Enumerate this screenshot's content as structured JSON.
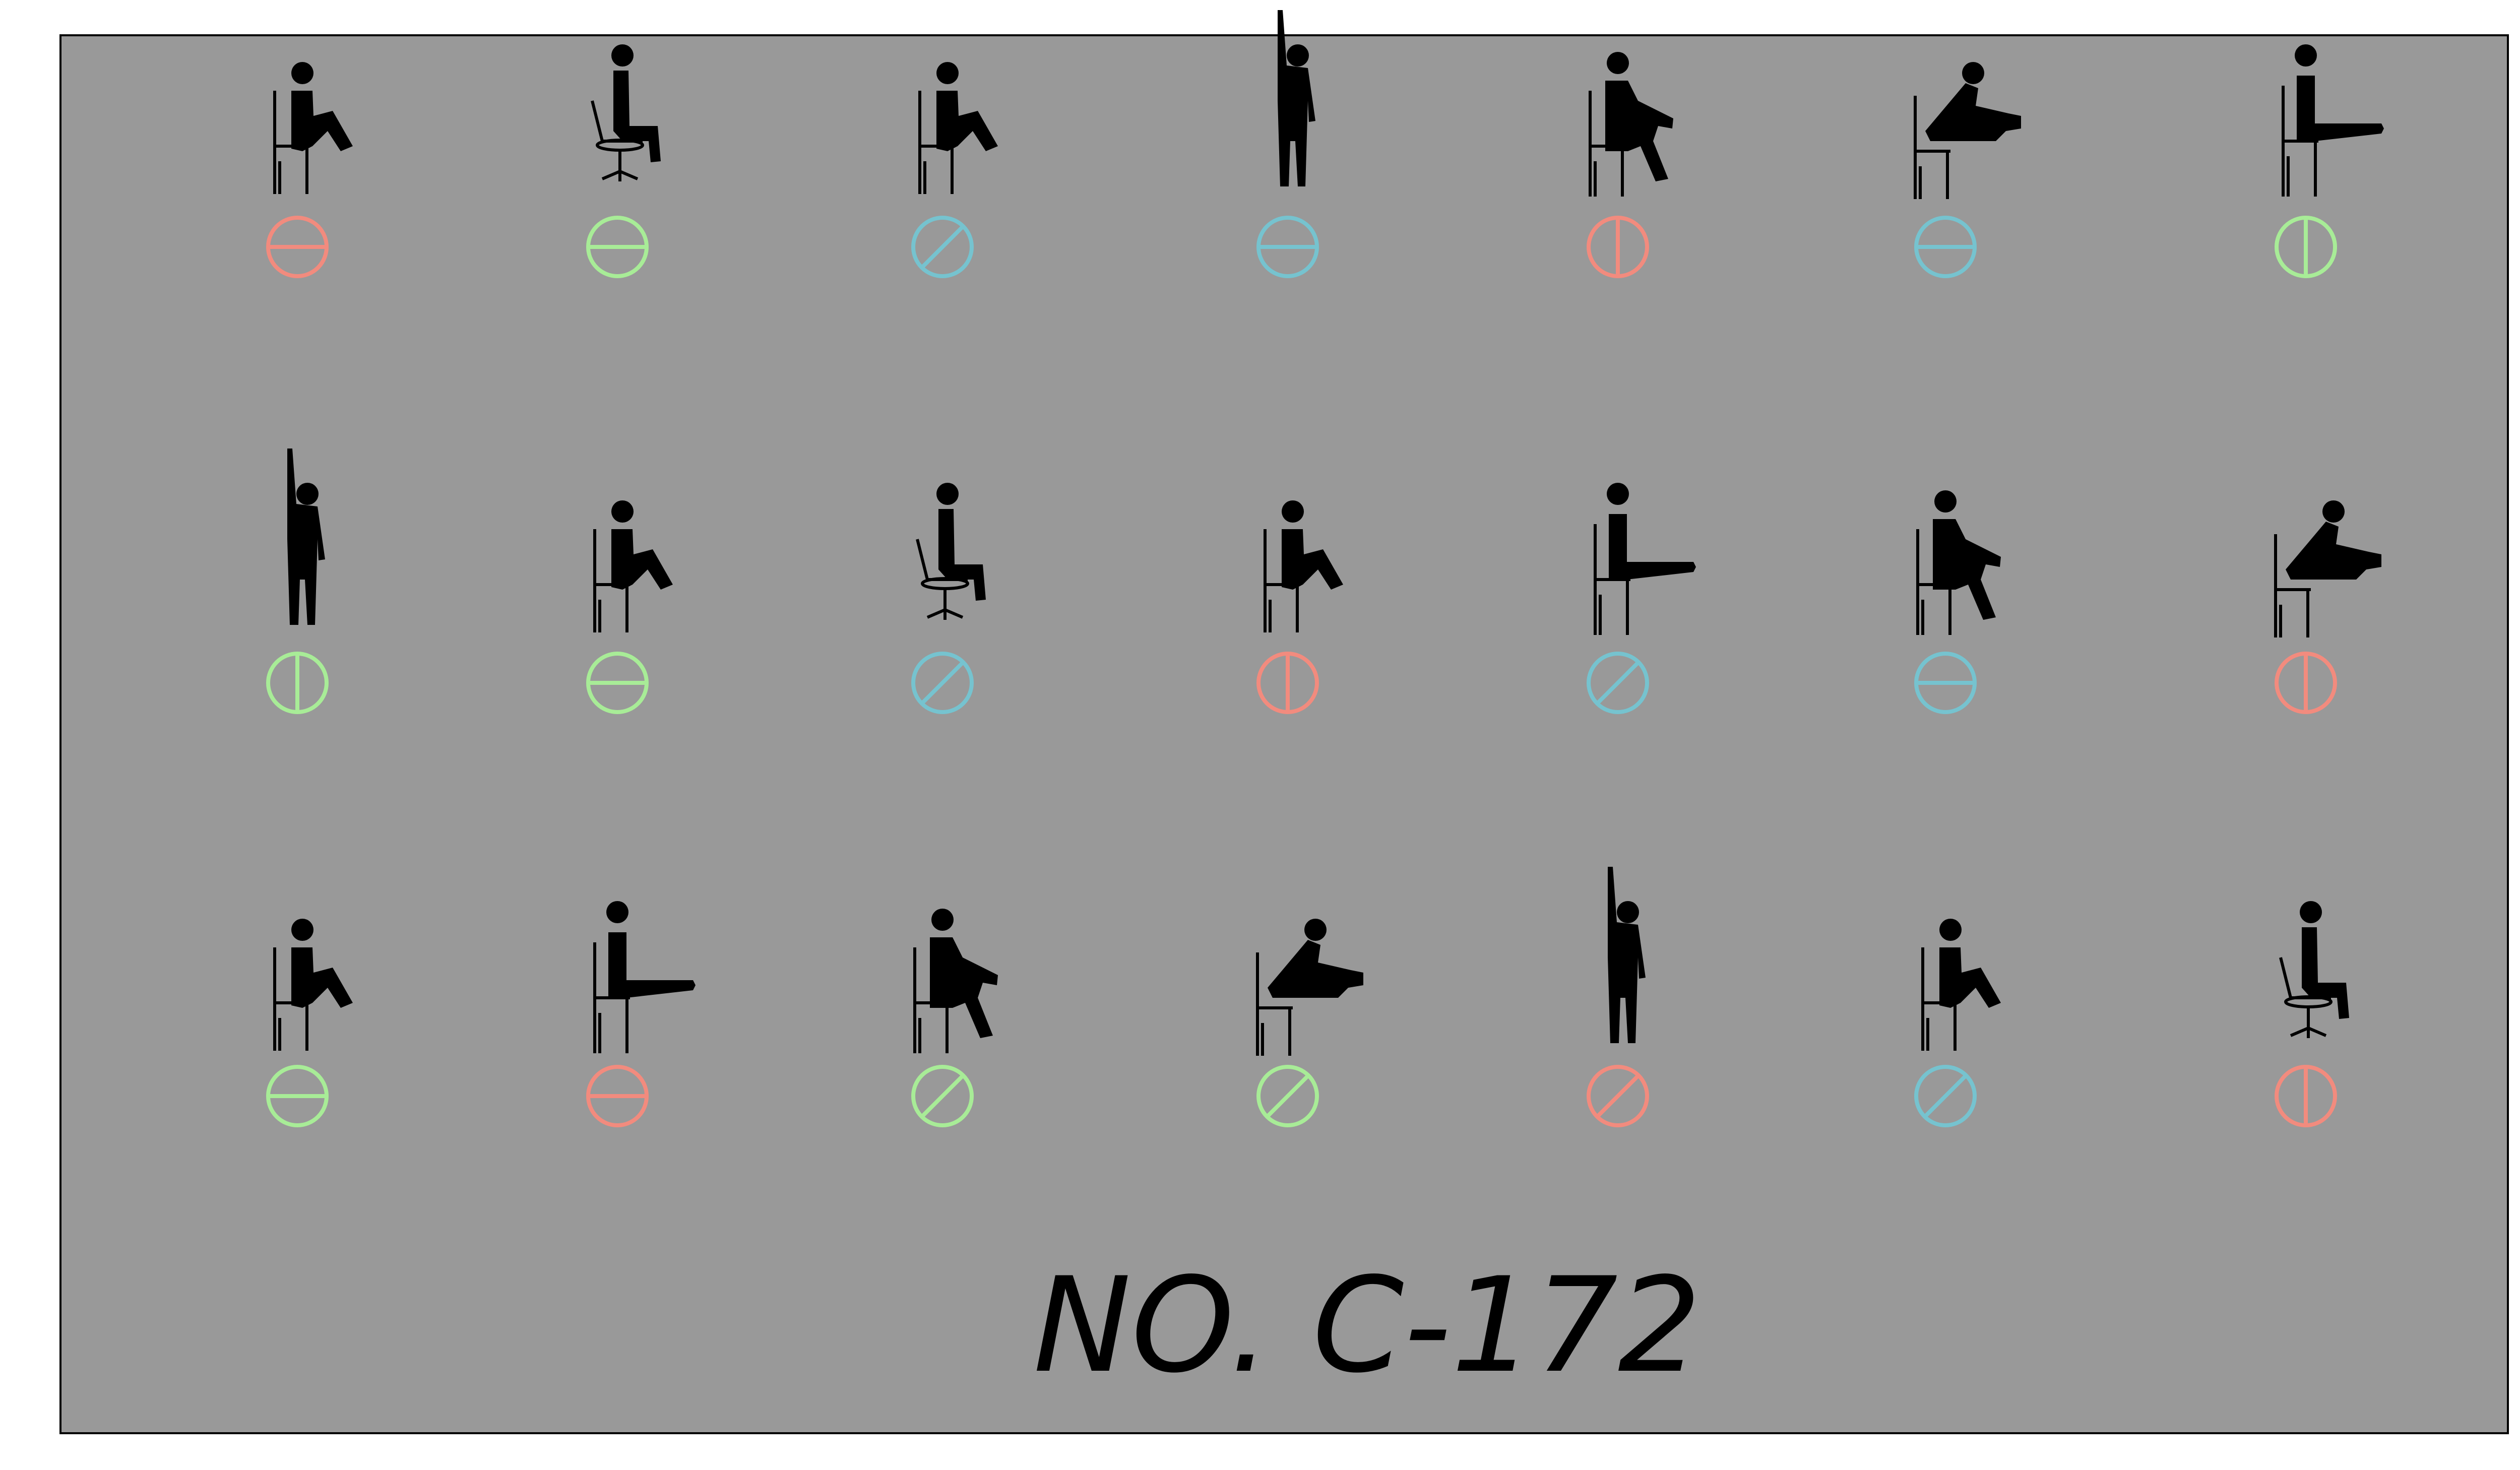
{
  "label": "NO. C-172",
  "colors": {
    "background": "#999999",
    "salmon": "#f28b7e",
    "green": "#a8ec97",
    "blue": "#76c3cf"
  },
  "rows": [
    [
      {
        "pose": "sit-knee-up",
        "symbol": "circle-horizontal-bar",
        "color": "salmon"
      },
      {
        "pose": "office-chair",
        "symbol": "circle-horizontal-bar",
        "color": "green"
      },
      {
        "pose": "sit-knee-up",
        "symbol": "circle-slash",
        "color": "blue"
      },
      {
        "pose": "stand-arm-raised",
        "symbol": "circle-horizontal-bar",
        "color": "blue"
      },
      {
        "pose": "sit-leg-stretch",
        "symbol": "circle-vertical-bar",
        "color": "salmon"
      },
      {
        "pose": "sit-reach-forward",
        "symbol": "circle-horizontal-bar",
        "color": "blue"
      },
      {
        "pose": "sit-leg-extended",
        "symbol": "circle-vertical-bar",
        "color": "green"
      }
    ],
    [
      {
        "pose": "stand-arm-raised",
        "symbol": "circle-vertical-bar",
        "color": "green"
      },
      {
        "pose": "sit-knee-up",
        "symbol": "circle-horizontal-bar",
        "color": "green"
      },
      {
        "pose": "office-chair",
        "symbol": "circle-slash",
        "color": "blue"
      },
      {
        "pose": "sit-knee-up",
        "symbol": "circle-vertical-bar",
        "color": "salmon"
      },
      {
        "pose": "sit-leg-extended",
        "symbol": "circle-slash",
        "color": "blue"
      },
      {
        "pose": "sit-leg-stretch",
        "symbol": "circle-horizontal-bar",
        "color": "blue"
      },
      {
        "pose": "sit-reach-forward",
        "symbol": "circle-vertical-bar",
        "color": "salmon"
      }
    ],
    [
      {
        "pose": "sit-knee-up",
        "symbol": "circle-horizontal-bar",
        "color": "green"
      },
      {
        "pose": "sit-leg-extended",
        "symbol": "circle-horizontal-bar",
        "color": "salmon"
      },
      {
        "pose": "sit-leg-stretch",
        "symbol": "circle-slash",
        "color": "green"
      },
      {
        "pose": "sit-reach-forward",
        "symbol": "circle-slash",
        "color": "green"
      },
      {
        "pose": "stand-arm-raised",
        "symbol": "circle-slash",
        "color": "salmon"
      },
      {
        "pose": "sit-knee-up",
        "symbol": "circle-slash",
        "color": "blue"
      },
      {
        "pose": "office-chair",
        "symbol": "circle-vertical-bar",
        "color": "salmon"
      }
    ]
  ]
}
